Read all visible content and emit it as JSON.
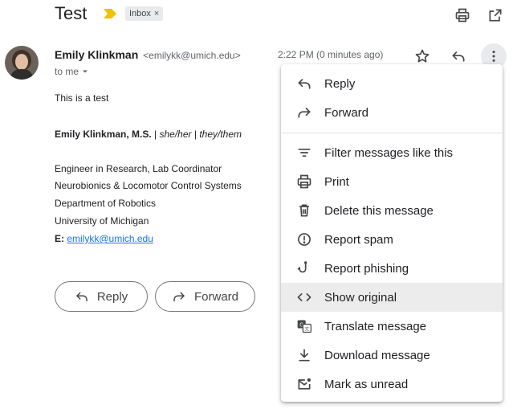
{
  "subject": "Test",
  "label_chip": {
    "text": "Inbox",
    "close": "×"
  },
  "sender": {
    "name": "Emily Klinkman",
    "email": "<emilykk@umich.edu>",
    "recipient": "to me",
    "time": "2:22 PM (0 minutes ago)"
  },
  "body": {
    "line": "This is a test",
    "signature": {
      "name": "Emily Klinkman, M.S.",
      "sep1": " | ",
      "pron1": "she/her",
      "sep2": " | ",
      "pron2": "they/them",
      "lines": [
        "Engineer in Research, Lab Coordinator",
        "Neurobionics & Locomotor Control Systems",
        "Department of Robotics",
        "University of Michigan"
      ],
      "email_label": "E:",
      "email_link": "emilykk@umich.edu"
    }
  },
  "buttons": {
    "reply": "Reply",
    "forward": "Forward"
  },
  "menu": {
    "items": [
      {
        "label": "Reply",
        "icon": "reply-icon"
      },
      {
        "label": "Forward",
        "icon": "forward-icon"
      },
      {
        "label": "Filter messages like this",
        "icon": "filter-icon"
      },
      {
        "label": "Print",
        "icon": "print-icon"
      },
      {
        "label": "Delete this message",
        "icon": "trash-icon"
      },
      {
        "label": "Report spam",
        "icon": "report-spam-icon"
      },
      {
        "label": "Report phishing",
        "icon": "phishing-hook-icon"
      },
      {
        "label": "Show original",
        "icon": "code-icon",
        "highlighted": true
      },
      {
        "label": "Translate message",
        "icon": "translate-icon"
      },
      {
        "label": "Download message",
        "icon": "download-icon"
      },
      {
        "label": "Mark as unread",
        "icon": "mark-unread-icon"
      }
    ]
  },
  "colors": {
    "important_marker": "#f2c200",
    "link": "#1a73e8",
    "menu_highlight": "#ececec"
  }
}
